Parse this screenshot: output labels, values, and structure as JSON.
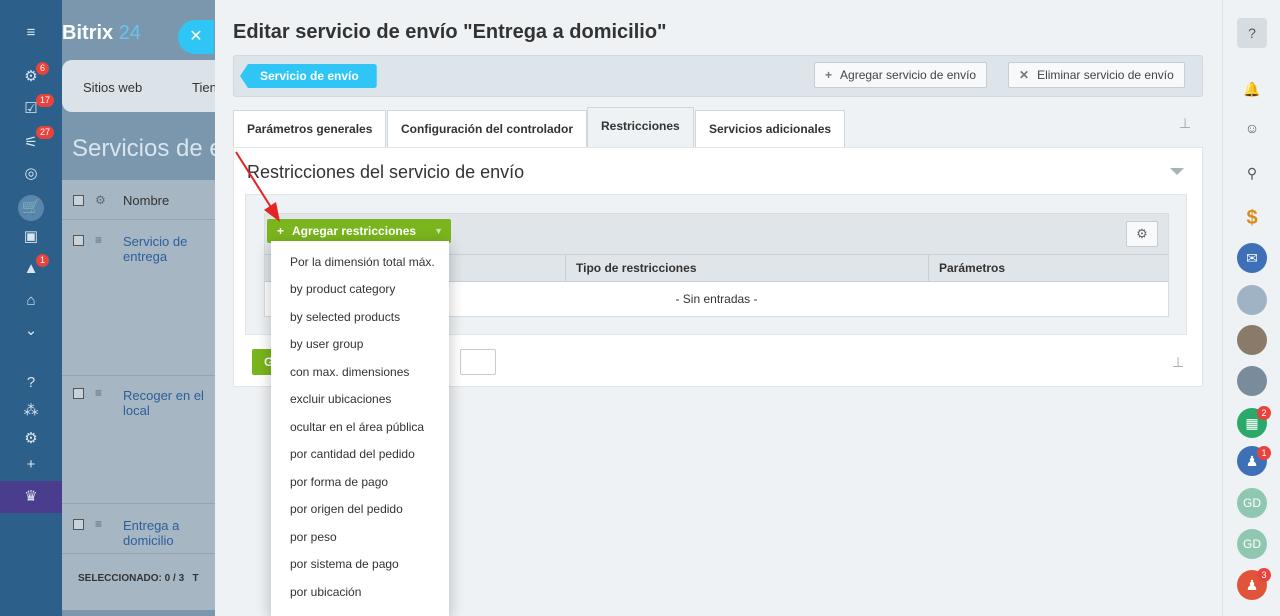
{
  "sidebar": {
    "badges": [
      "6",
      "17",
      "27",
      "1"
    ]
  },
  "background": {
    "logo_main": "Bitrix",
    "logo_num": "24",
    "close": "✕",
    "tab_sites": "Sitios web",
    "tab_store": "Tien",
    "page_title": "Servicios de en",
    "col_name": "Nombre",
    "rows": [
      "Servicio de entrega",
      "Recoger en el local",
      "Entrega a domicilio"
    ],
    "selected": "SELECCIONADO: 0 / 3",
    "total_frag": "T"
  },
  "slider": {
    "title": "Editar servicio de envío \"Entrega a domicilio\"",
    "service_button": "Servicio de envío",
    "add_service": "Agregar servicio de envío",
    "delete_service": "Eliminar servicio de envío",
    "tabs": [
      "Parámetros generales",
      "Configuración del controlador",
      "Restricciones",
      "Servicios adicionales"
    ],
    "section_title": "Restricciones del servicio de envío",
    "add_restrictions": "Agregar restricciones",
    "col_type": "Tipo de restricciones",
    "col_params": "Parámetros",
    "empty": "- Sin entradas -",
    "save_frag": "G"
  },
  "dropdown": {
    "items": [
      "Por la dimensión total máx.",
      "by product category",
      "by selected products",
      "by user group",
      "con max. dimensiones",
      "excluir ubicaciones",
      "ocultar en el área pública",
      "por cantidad del pedido",
      "por forma de pago",
      "por origen del pedido",
      "por peso",
      "por sistema de pago",
      "por ubicación"
    ]
  },
  "rightbar": {
    "badges": [
      "2",
      "1",
      "3"
    ],
    "initials": [
      "GD",
      "GD"
    ]
  },
  "colors": {
    "accent": "#2fc6f6",
    "green": "#7ab51d",
    "sidebar": "#2c5f8a"
  }
}
